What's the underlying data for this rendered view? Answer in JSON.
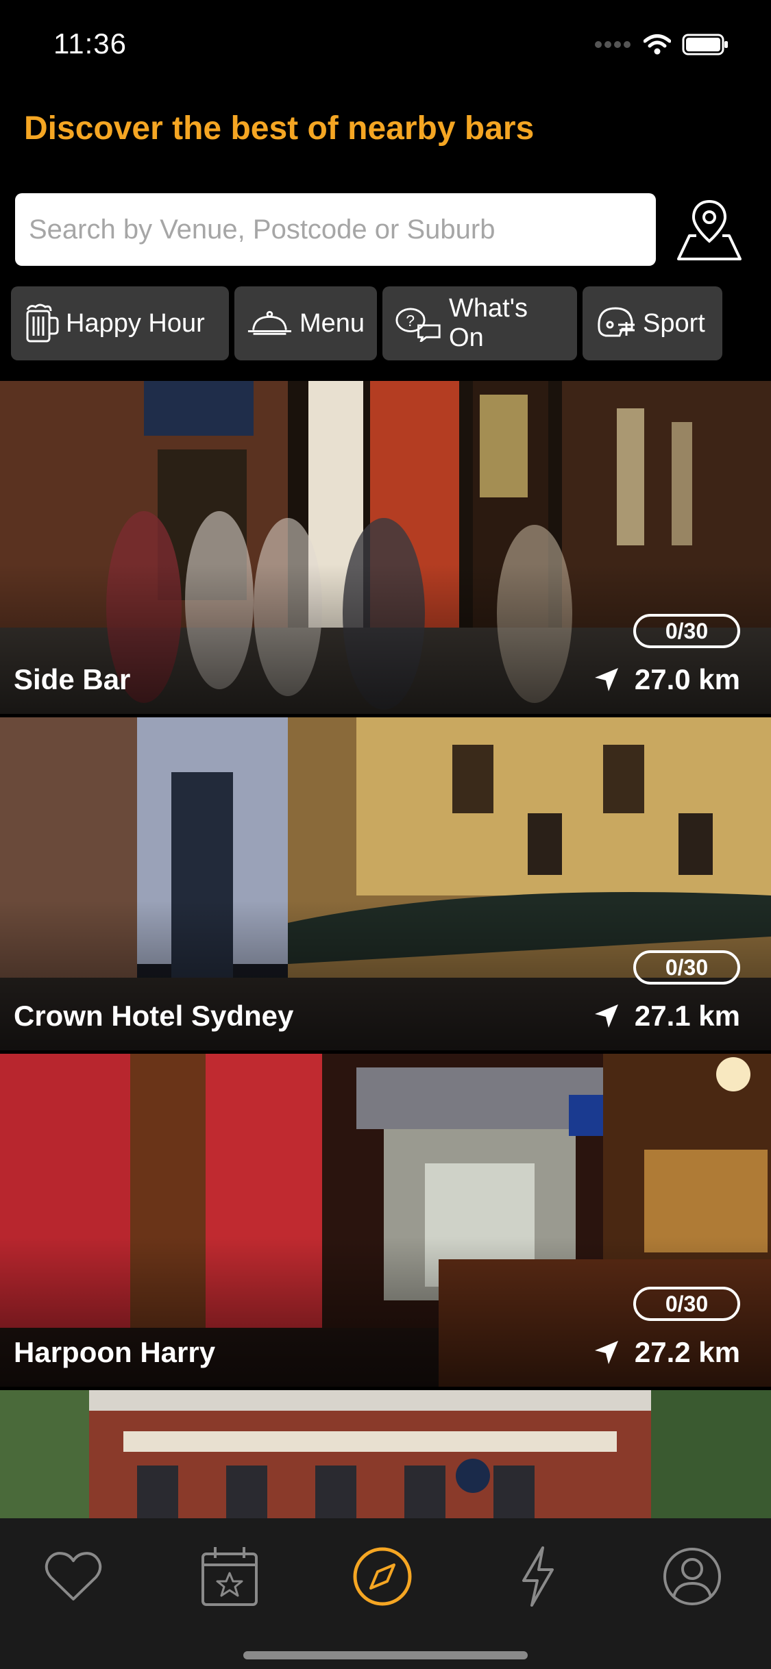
{
  "status_bar": {
    "time": "11:36"
  },
  "colors": {
    "accent": "#F5A623",
    "background": "#000000",
    "chip": "#3A3A3A",
    "tab_bar": "#1B1B1B"
  },
  "header": {
    "title": "Discover the best of nearby bars"
  },
  "search": {
    "value": "",
    "placeholder": "Search by Venue, Postcode or Suburb",
    "map_icon": "map-pin-icon"
  },
  "filters": [
    {
      "label": "Happy Hour",
      "icon": "beer-mug-icon"
    },
    {
      "label": "Menu",
      "icon": "food-cloche-icon"
    },
    {
      "label": "What's On",
      "icon": "chat-question-icon"
    },
    {
      "label": "Sport",
      "icon": "football-helmet-icon"
    }
  ],
  "venues": [
    {
      "name": "Side Bar",
      "badge": "0/30",
      "distance": "27.0 km"
    },
    {
      "name": "Crown Hotel Sydney",
      "badge": "0/30",
      "distance": "27.1 km"
    },
    {
      "name": "Harpoon Harry",
      "badge": "0/30",
      "distance": "27.2 km"
    },
    {
      "name": "",
      "badge": "",
      "distance": ""
    }
  ],
  "tab_bar": {
    "tabs": [
      {
        "icon": "heart-icon",
        "active": false
      },
      {
        "icon": "calendar-star-icon",
        "active": false
      },
      {
        "icon": "compass-icon",
        "active": true
      },
      {
        "icon": "lightning-icon",
        "active": false
      },
      {
        "icon": "profile-icon",
        "active": false
      }
    ]
  }
}
